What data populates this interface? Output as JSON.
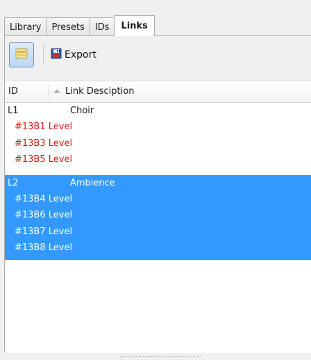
{
  "tabs": [
    {
      "label": "Library",
      "active": false
    },
    {
      "label": "Presets",
      "active": false
    },
    {
      "label": "IDs",
      "active": false
    },
    {
      "label": "Links",
      "active": true
    }
  ],
  "toolbar": {
    "export_label": "Export",
    "link_icon": "link-list-icon",
    "export_icon": "floppy-disk-icon"
  },
  "grid": {
    "columns": [
      "ID",
      "Link Desciption"
    ],
    "groups": [
      {
        "id": "L1",
        "description": "Choir",
        "selected": false,
        "items": [
          "#13B1 Level",
          "#13B3 Level",
          "#13B5 Level"
        ]
      },
      {
        "id": "L2",
        "description": "Ambience",
        "selected": true,
        "items": [
          "#13B4 Level",
          "#13B6 Level",
          "#13B7 Level",
          "#13B8 Level"
        ]
      }
    ]
  },
  "colors": {
    "selection": "#3399ff",
    "member_text": "#d41a1a"
  }
}
